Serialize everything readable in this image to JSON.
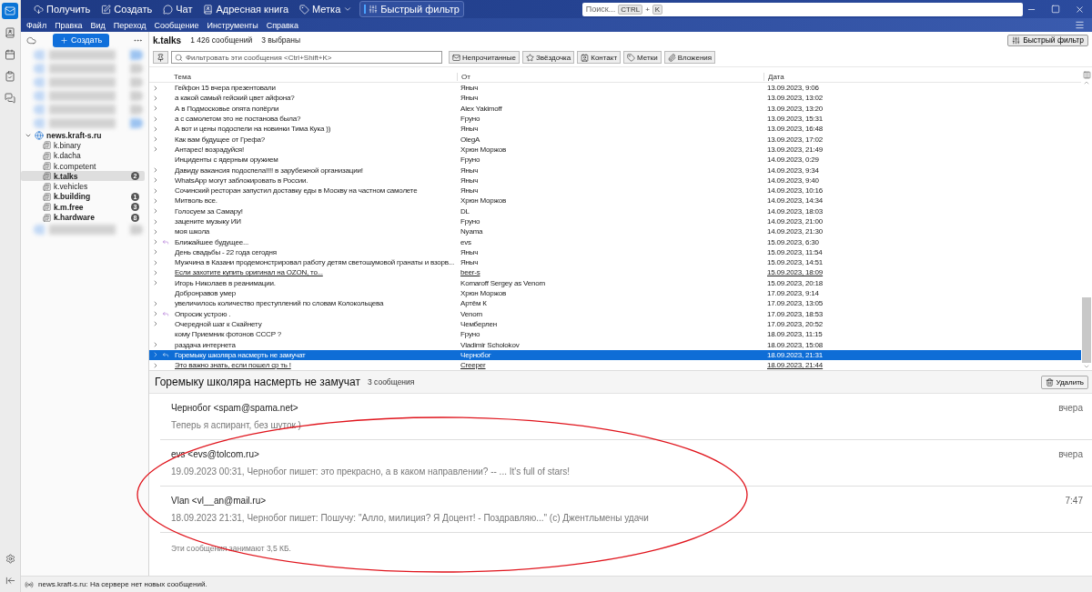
{
  "toolbar": {
    "buttons": [
      {
        "label": "Получить",
        "dropdown": false
      },
      {
        "label": "Создать",
        "dropdown": false
      },
      {
        "label": "Чат",
        "dropdown": false
      },
      {
        "label": "Адресная книга",
        "dropdown": false
      },
      {
        "label": "Метка",
        "dropdown": true
      }
    ],
    "quick_filter": "Быстрый фильтр"
  },
  "search": {
    "placeholder": "Поиск...",
    "shortcut": [
      "CTRL",
      "+",
      "K"
    ]
  },
  "menu": [
    "Файл",
    "Правка",
    "Вид",
    "Переход",
    "Сообщение",
    "Инструменты",
    "Справка"
  ],
  "folder_pane": {
    "new_button": "Создать"
  },
  "accounts": [
    {
      "name": "news.kraft-s.ru",
      "expanded": true,
      "children": [
        {
          "name": "k.binary",
          "unread": false,
          "selected": false
        },
        {
          "name": "k.dacha",
          "unread": false,
          "selected": false
        },
        {
          "name": "k.competent",
          "unread": false,
          "selected": false
        },
        {
          "name": "k.talks",
          "unread": true,
          "selected": true,
          "count": "2"
        },
        {
          "name": "k.vehicles",
          "unread": false,
          "selected": false
        },
        {
          "name": "k.building",
          "unread": true,
          "selected": false,
          "count": "1"
        },
        {
          "name": "k.m.free",
          "unread": true,
          "selected": false,
          "count": "3"
        },
        {
          "name": "k.hardware",
          "unread": true,
          "selected": false,
          "count": "8"
        }
      ]
    }
  ],
  "folder_header": {
    "title": "k.talks",
    "count": "1 426 сообщений",
    "selected_count": "3 выбраны",
    "quick_filter": "Быстрый фильтр"
  },
  "filter_bar": {
    "placeholder": "Фильтровать эти сообщения <Ctrl+Shift+K>",
    "buttons": [
      "Непрочитанные",
      "Звёздочка",
      "Контакт",
      "Метки",
      "Вложения"
    ]
  },
  "table": {
    "columns": [
      "Тема",
      "От",
      "Дата"
    ],
    "rows": [
      {
        "subject": "Гейфон 15 вчера презентовали",
        "from": "Яныч",
        "date": "13.09.2023, 9:06",
        "thread": true,
        "replied": false,
        "unread": false,
        "selected": false
      },
      {
        "subject": "а какой самый гейский цвет айфона?",
        "from": "Яныч",
        "date": "13.09.2023, 13:02",
        "thread": true,
        "replied": false,
        "unread": false,
        "selected": false
      },
      {
        "subject": "А в Подмосковье опята попёрли",
        "from": "Alex Yakimoff",
        "date": "13.09.2023, 13:20",
        "thread": true,
        "replied": false,
        "unread": false,
        "selected": false
      },
      {
        "subject": "а с самолетом это не постанова была?",
        "from": "Fpyнo",
        "date": "13.09.2023, 15:31",
        "thread": true,
        "replied": false,
        "unread": false,
        "selected": false
      },
      {
        "subject": "А вот и цены подоспели на новинки Тима Кука ))",
        "from": "Яныч",
        "date": "13.09.2023, 16:48",
        "thread": true,
        "replied": false,
        "unread": false,
        "selected": false
      },
      {
        "subject": "Как вам будущее от Грефа?",
        "from": "OlegA",
        "date": "13.09.2023, 17:02",
        "thread": true,
        "replied": false,
        "unread": false,
        "selected": false
      },
      {
        "subject": "Антарес! возрадуйся!",
        "from": "Хрюн Моржов",
        "date": "13.09.2023, 21:49",
        "thread": true,
        "replied": false,
        "unread": false,
        "selected": false
      },
      {
        "subject": "Инциденты с ядерным оружием",
        "from": "Fpyнo",
        "date": "14.09.2023, 0:29",
        "thread": false,
        "replied": false,
        "unread": false,
        "selected": false
      },
      {
        "subject": "Давиду вакансия подоспела!!!! в зарубежной организации!",
        "from": "Яныч",
        "date": "14.09.2023, 9:34",
        "thread": true,
        "replied": false,
        "unread": false,
        "selected": false
      },
      {
        "subject": "WhatsApp могут заблокировать в России.",
        "from": "Яныч",
        "date": "14.09.2023, 9:40",
        "thread": true,
        "replied": false,
        "unread": false,
        "selected": false
      },
      {
        "subject": "Сочинский ресторан запустил доставку еды в Москву на частном самолете",
        "from": "Яныч",
        "date": "14.09.2023, 10:16",
        "thread": true,
        "replied": false,
        "unread": false,
        "selected": false
      },
      {
        "subject": "Митволь все.",
        "from": "Хрюн Моржов",
        "date": "14.09.2023, 14:34",
        "thread": true,
        "replied": false,
        "unread": false,
        "selected": false
      },
      {
        "subject": "Голосуем за Самару!",
        "from": "DL",
        "date": "14.09.2023, 18:03",
        "thread": true,
        "replied": false,
        "unread": false,
        "selected": false
      },
      {
        "subject": "зацените музыку ИИ",
        "from": "Fpyнo",
        "date": "14.09.2023, 21:00",
        "thread": true,
        "replied": false,
        "unread": false,
        "selected": false
      },
      {
        "subject": "моя школа",
        "from": "Nyama",
        "date": "14.09.2023, 21:30",
        "thread": true,
        "replied": false,
        "unread": false,
        "selected": false
      },
      {
        "subject": "Ближайшее будущее...",
        "from": "evs",
        "date": "15.09.2023, 6:30",
        "thread": true,
        "replied": true,
        "unread": false,
        "selected": false
      },
      {
        "subject": "День свадьбы - 22 года сегодня",
        "from": "Яныч",
        "date": "15.09.2023, 11:54",
        "thread": true,
        "replied": false,
        "unread": false,
        "selected": false
      },
      {
        "subject": "Мужчина в Казани продемонстрировал работу детям светошумовой гранаты и взорв...",
        "from": "Яныч",
        "date": "15.09.2023, 14:51",
        "thread": true,
        "replied": false,
        "unread": false,
        "selected": false
      },
      {
        "subject": "Если захотите купить оригинал на OZON, то...",
        "from": "beer-s",
        "date": "15.09.2023, 18:09",
        "thread": true,
        "replied": false,
        "unread": true,
        "selected": false
      },
      {
        "subject": "Игорь Николаев в реанимации.",
        "from": "Komaroff Sergey as Venom",
        "date": "15.09.2023, 20:18",
        "thread": true,
        "replied": false,
        "unread": false,
        "selected": false
      },
      {
        "subject": "Добронравов умер",
        "from": "Хрюн Моржов",
        "date": "17.09.2023, 9:14",
        "thread": false,
        "replied": false,
        "unread": false,
        "selected": false
      },
      {
        "subject": "увеличилось количество преступлений по словам Колокольцева",
        "from": "Артём К",
        "date": "17.09.2023, 13:05",
        "thread": true,
        "replied": false,
        "unread": false,
        "selected": false
      },
      {
        "subject": "Опросик устрою .",
        "from": "Venom",
        "date": "17.09.2023, 18:53",
        "thread": true,
        "replied": true,
        "unread": false,
        "selected": false
      },
      {
        "subject": "Очередной шаг к Скайнету",
        "from": "Чемберлен",
        "date": "17.09.2023, 20:52",
        "thread": true,
        "replied": false,
        "unread": false,
        "selected": false
      },
      {
        "subject": "кому Приемник фотонов СССР ?",
        "from": "Fpyнo",
        "date": "18.09.2023, 11:15",
        "thread": false,
        "replied": false,
        "unread": false,
        "selected": false
      },
      {
        "subject": "раздача интернета",
        "from": "Vladimir Scholokov",
        "date": "18.09.2023, 15:08",
        "thread": true,
        "replied": false,
        "unread": false,
        "selected": false
      },
      {
        "subject": "Горемыку школяра насмерть не замучат",
        "from": "Чернобог",
        "date": "18.09.2023, 21:31",
        "thread": true,
        "replied": true,
        "unread": false,
        "selected": true
      },
      {
        "subject": "Это важно знать, если пошел ср ть !",
        "from": "Creeper",
        "date": "18.09.2023, 21:44",
        "thread": true,
        "replied": false,
        "unread": true,
        "selected": false
      }
    ]
  },
  "preview": {
    "title": "Горемыку школяра насмерть не замучат",
    "count": "3 сообщения",
    "delete": "Удалить",
    "messages": [
      {
        "author": "Чернобог <spam@spama.net>",
        "snippet": "Теперь я аспирант, без шуток )",
        "time": "вчера"
      },
      {
        "author": "evs <evs@tolcom.ru>",
        "snippet": "19.09.2023 00:31, Чернобог пишет: это прекрасно, а в каком направлении? -- ... It's full of stars!",
        "time": "вчера"
      },
      {
        "author": "Vlan <vl__an@mail.ru>",
        "snippet": "18.09.2023 21:31, Чернобог пишет: Пошучу: \"Алло, милиция? Я Доцент! - Поздравляю...\" (с) Джентльмены удачи",
        "time": "7:47"
      }
    ],
    "footer": "Эти сообщения занимают 3,5 КБ."
  },
  "status_bar": "news.kraft-s.ru: На сервере нет новых сообщений."
}
